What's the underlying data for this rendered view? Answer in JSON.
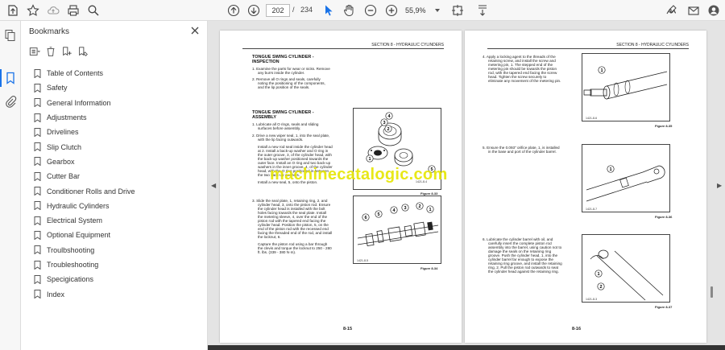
{
  "toolbar": {
    "page_current": "202",
    "page_separator": "/",
    "page_total": "234",
    "zoom": "55,9%"
  },
  "bookmarks": {
    "title": "Bookmarks",
    "items": [
      "Table of Contents",
      "Safety",
      "General Information",
      "Adjustments",
      "Drivelines",
      "Slip Clutch",
      "Gearbox",
      "Cutter Bar",
      "Conditioner Rolls and Drive",
      "Hydraulic Cylinders",
      "Electrical System",
      "Optional Equipment",
      "Troulbshooting",
      "Troubleshooting",
      "Specigications",
      "Index"
    ]
  },
  "left_page": {
    "header": "SECTION 8 - HYDRAULIC CYLINDERS",
    "h1": "TONGUE SWING CYLINDER -",
    "h1b": "INSPECTION",
    "p1": "1.  Examine the parts for wear or nicks. Remove",
    "p1b": "any burrs inside the cylinder.",
    "p2": "2.  Remove all O rings and seals, carefully",
    "p2b": "noting the positioning of the components,",
    "p2c": "and the lip position of the seals.",
    "h2": "TONGUE SWING CYLINDER -",
    "h2b": "ASSEMBLY",
    "a1": "1.  Lubricate all O rings, seals and sliding",
    "a1b": "surfaces before assembly.",
    "a2": "2.  Drive a new wiper seal, 1, into the seal plate,",
    "a2b": "with the lip facing outwards.",
    "a3": "Install a new rod seal inside the cylinder head",
    "a3b": "at 2. Install a back-up washer and O ring in",
    "a3c": "the outer groove, 3, of the cylinder head, with",
    "a3d": "the back-up washer positioned towards the",
    "a3e": "outer face. Install an O ring and two back-up",
    "a3f": "washers in the inner groove, 4, of the cylinder",
    "a3g": "head, with the O ring positioned in between",
    "a3h": "the two back-up washers.",
    "a4": "Install a new seal, 5, onto the piston.",
    "s3": "3.  Slide the seal plate, 1, retaining ring, 2, and",
    "s3b": "cylinder head, 3, onto the piston rod. Ensure",
    "s3c": "the cylinder head is installed with the bolt",
    "s3d": "holes facing towards the seal plate. Install",
    "s3e": "the metering sleeve, 4, over the end of the",
    "s3f": "piston rod with the tapered end facing the",
    "s3g": "cylinder head. Position the piston, 5, on the",
    "s3h": "end of the piston rod with the recessed end",
    "s3i": "facing the threaded end of the rod, and install",
    "s3j": "the locknut, 6.",
    "s4": "Capture the piston rod using a bar through",
    "s4b": "the clevis and torque the locknut to 250 - 280",
    "s4c": "ft. lbs. (339 - 380 N·m).",
    "fig33": "Figure 8-33",
    "fig34": "Figure 8-34",
    "figno33": "1421-8-4",
    "figno34": "1421-8-5",
    "footer": "8-15",
    "callouts_a": [
      "4",
      "3",
      "2",
      "1",
      "5"
    ],
    "callouts_b": [
      "6",
      "5",
      "4",
      "3",
      "2",
      "1"
    ]
  },
  "right_page": {
    "header": "SECTION 8 - HYDRAULIC CYLINDERS",
    "p4": "4.  Apply a locking agent to the threads of the",
    "p4b": "retaining screw, and install the screw and",
    "p4c": "metering pin, 1. The stepped end of the",
    "p4d": "metering pin should be towards the piston",
    "p4e": "rod, with the tapered end facing the screw",
    "p4f": "head. Tighten the screw securely to",
    "p4g": "eliminate any movement of the metering pin.",
    "p5": "5.  Ensure the 0.093\" orifice plate, 1, is installed",
    "p5b": "in the base and port of the cylinder barrel.",
    "p6": "6.  Lubricate the cylinder barrel with oil, and",
    "p6b": "carefully insert the complete piston rod",
    "p6c": "assembly into the barrel, using caution not to",
    "p6d": "damage the seals on the retaining ring",
    "p6e": "groove. Push the cylinder head, 1, into the",
    "p6f": "cylinder barrel far enough to expose the",
    "p6g": "retaining ring groove, and install the retaining",
    "p6h": "ring, 2. Pull the piston rod outwards to seat",
    "p6i": "the cylinder head against the retaining ring.",
    "fig35": "Figure 8-35",
    "fig36": "Figure 8-36",
    "fig37": "Figure 8-37",
    "figno35": "1421-8-6",
    "figno36": "1421-8-7",
    "figno37": "1421-8-3",
    "footer": "8-16",
    "callouts": [
      "1",
      "1",
      "1",
      "2"
    ]
  },
  "watermark": "machinecatalogic.com"
}
